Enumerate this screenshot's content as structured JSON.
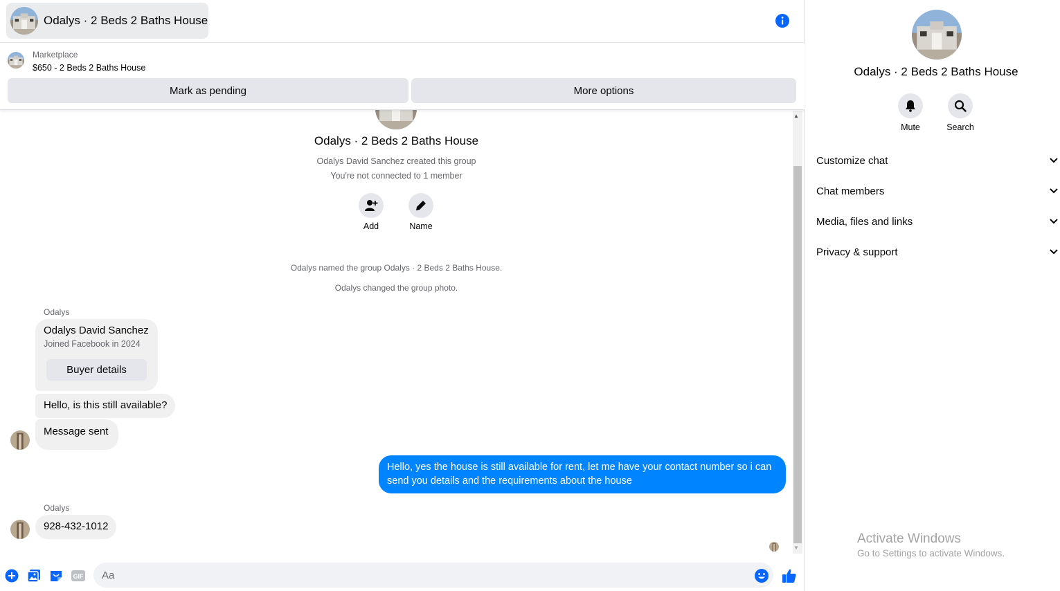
{
  "header": {
    "title": "Odalys · 2 Beds 2 Baths House",
    "info_icon": "info-icon"
  },
  "marketplace": {
    "label": "Marketplace",
    "listing": "$650 - 2 Beds 2 Baths House",
    "mark_pending_label": "Mark as pending",
    "more_options_label": "More options"
  },
  "intro": {
    "title": "Odalys · 2 Beds 2 Baths House",
    "created": "Odalys David Sanchez created this group",
    "not_connected": "You're not connected to 1 member",
    "add_label": "Add",
    "name_label": "Name"
  },
  "system_messages": [
    "Odalys named the group Odalys · 2 Beds 2 Baths House.",
    "Odalys changed the group photo."
  ],
  "messages": {
    "sender1": "Odalys",
    "card": {
      "name": "Odalys David Sanchez",
      "joined": "Joined Facebook in 2024",
      "button": "Buyer details"
    },
    "msg1": "Hello, is this still available?",
    "msg2": "Message sent",
    "outgoing": "Hello, yes the house is still available for rent, let me have your contact number so i can send you details and the requirements about the house",
    "sender2": "Odalys",
    "msg3": "928-432-1012"
  },
  "composer": {
    "placeholder": "Aa",
    "icons": [
      "plus-circle-icon",
      "photo-icon",
      "sticker-icon",
      "gif-icon",
      "emoji-icon",
      "like-icon"
    ]
  },
  "side_panel": {
    "title": "Odalys · 2 Beds 2 Baths House",
    "mute_label": "Mute",
    "search_label": "Search",
    "sections": [
      "Customize chat",
      "Chat members",
      "Media, files and links",
      "Privacy & support"
    ]
  },
  "watermark": {
    "line1": "Activate Windows",
    "line2": "Go to Settings to activate Windows."
  },
  "colors": {
    "accent": "#0084ff",
    "bubble_in": "#f0f0f0",
    "button_grey": "#e4e6eb",
    "secondary_text": "#65676b"
  }
}
